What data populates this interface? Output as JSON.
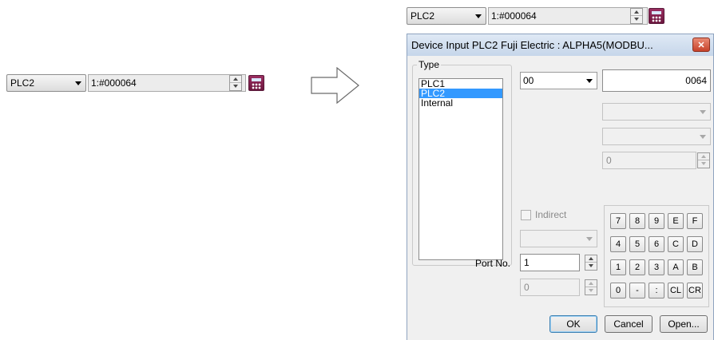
{
  "left_widget": {
    "plc_selected": "PLC2",
    "address_value": "1:#000064"
  },
  "top_widget": {
    "plc_selected": "PLC2",
    "address_value": "1:#000064"
  },
  "dialog": {
    "title": "Device Input  PLC2 Fuji Electric : ALPHA5(MODBU...",
    "close_glyph": "✕",
    "type_group_label": "Type",
    "type_items": [
      "PLC1",
      "PLC2",
      "Internal"
    ],
    "type_selected": "PLC2",
    "device_combo_value": "00",
    "address_value": "0064",
    "offset_value": "0",
    "indirect_label": "Indirect",
    "port_label": "Port No.",
    "port_value": "1",
    "port_sub_value": "0",
    "keypad": {
      "row1": [
        "7",
        "8",
        "9",
        "E",
        "F"
      ],
      "row2": [
        "4",
        "5",
        "6",
        "C",
        "D"
      ],
      "row3": [
        "1",
        "2",
        "3",
        "A",
        "B"
      ],
      "row4": [
        "0",
        "-",
        ":",
        "CL",
        "CR"
      ]
    },
    "ok_label": "OK",
    "cancel_label": "Cancel",
    "open_label": "Open..."
  },
  "icons": {
    "calculator": "calculator-icon",
    "arrow": "right-arrow-icon"
  },
  "colors": {
    "selection": "#3399ff",
    "calc_icon": "#8b2452",
    "close_button": "#c7422a"
  }
}
